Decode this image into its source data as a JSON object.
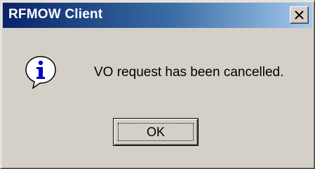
{
  "window": {
    "title": "RFMOW Client"
  },
  "dialog": {
    "icon": "information-icon",
    "message": "VO request has been cancelled.",
    "ok_label": "OK"
  },
  "colors": {
    "titlebar_start": "#0a246a",
    "titlebar_end": "#a6caf0",
    "face": "#d4d0c8",
    "icon_blue": "#0000c8"
  }
}
